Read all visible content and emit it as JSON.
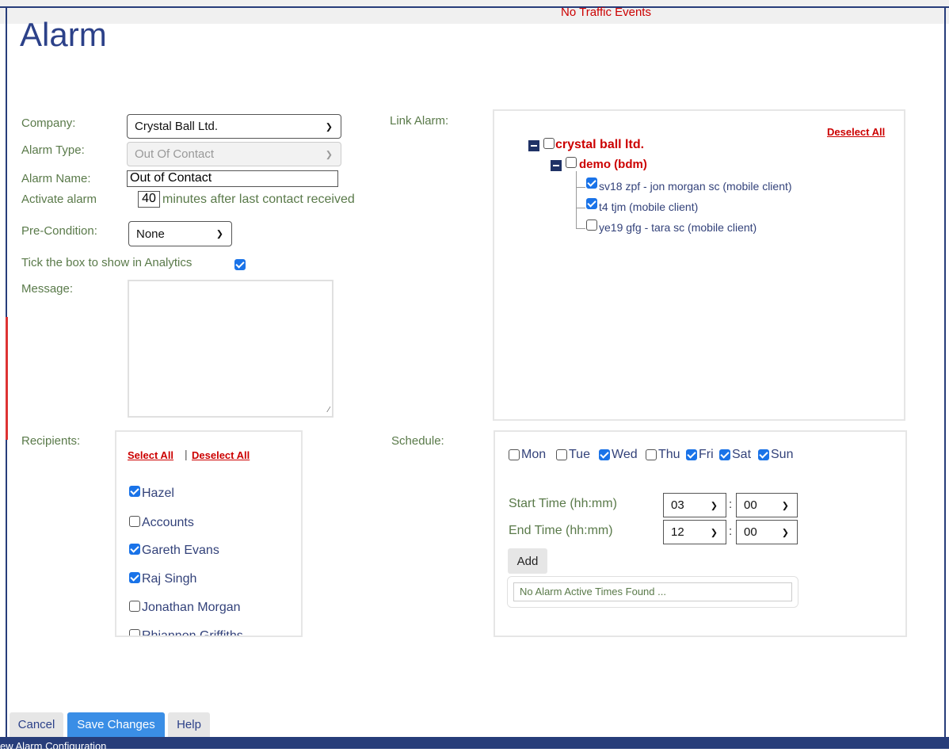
{
  "header": {
    "traffic": "No Traffic Events",
    "title": "Alarm"
  },
  "form": {
    "company_label": "Company:",
    "company_value": "Crystal Ball Ltd.",
    "alarm_type_label": "Alarm Type:",
    "alarm_type_value": "Out Of Contact",
    "alarm_name_label": "Alarm Name:",
    "alarm_name_value": "Out of Contact",
    "activate_label": "Activate alarm",
    "activate_minutes": "40",
    "activate_suffix": "minutes after last contact received",
    "precondition_label": "Pre-Condition:",
    "precondition_value": "None",
    "analytics_label": "Tick the box to show in Analytics",
    "analytics_checked": true,
    "message_label": "Message:",
    "message_value": ""
  },
  "link_alarm": {
    "label": "Link Alarm:",
    "deselect_all": "Deselect All",
    "tree": {
      "company": "crystal ball ltd.",
      "group": "demo (bdm)",
      "items": [
        {
          "label": "sv18 zpf - jon morgan sc (mobile client)",
          "checked": true
        },
        {
          "label": "t4 tjm (mobile client)",
          "checked": true
        },
        {
          "label": "ye19 gfg - tara sc (mobile client)",
          "checked": false
        }
      ]
    }
  },
  "recipients": {
    "label": "Recipients:",
    "select_all": "Select All",
    "separator": "|",
    "deselect_all": "Deselect All",
    "items": [
      {
        "name": "Hazel",
        "checked": true
      },
      {
        "name": "Accounts",
        "checked": false
      },
      {
        "name": "Gareth Evans",
        "checked": true
      },
      {
        "name": "Raj Singh",
        "checked": true
      },
      {
        "name": "Jonathan Morgan",
        "checked": false
      },
      {
        "name": "Rhiannon Griffiths",
        "checked": false
      }
    ]
  },
  "schedule": {
    "label": "Schedule:",
    "days": [
      {
        "name": "Mon",
        "checked": false
      },
      {
        "name": "Tue",
        "checked": false
      },
      {
        "name": "Wed",
        "checked": true
      },
      {
        "name": "Thu",
        "checked": false
      },
      {
        "name": "Fri",
        "checked": true
      },
      {
        "name": "Sat",
        "checked": true
      },
      {
        "name": "Sun",
        "checked": true
      }
    ],
    "start_label": "Start Time (hh:mm)",
    "start_hour": "03",
    "start_min": "00",
    "end_label": "End Time (hh:mm)",
    "end_hour": "12",
    "end_min": "00",
    "colon": ":",
    "add_label": "Add",
    "no_times": "No Alarm Active Times Found ..."
  },
  "footer": {
    "cancel": "Cancel",
    "save": "Save Changes",
    "help": "Help",
    "bottom_text": "ew Alarm Configuration"
  },
  "colors": {
    "accent": "#1a73e8",
    "navy": "#273d7a",
    "label_green": "#5a7a4a",
    "red": "#cc0000"
  }
}
